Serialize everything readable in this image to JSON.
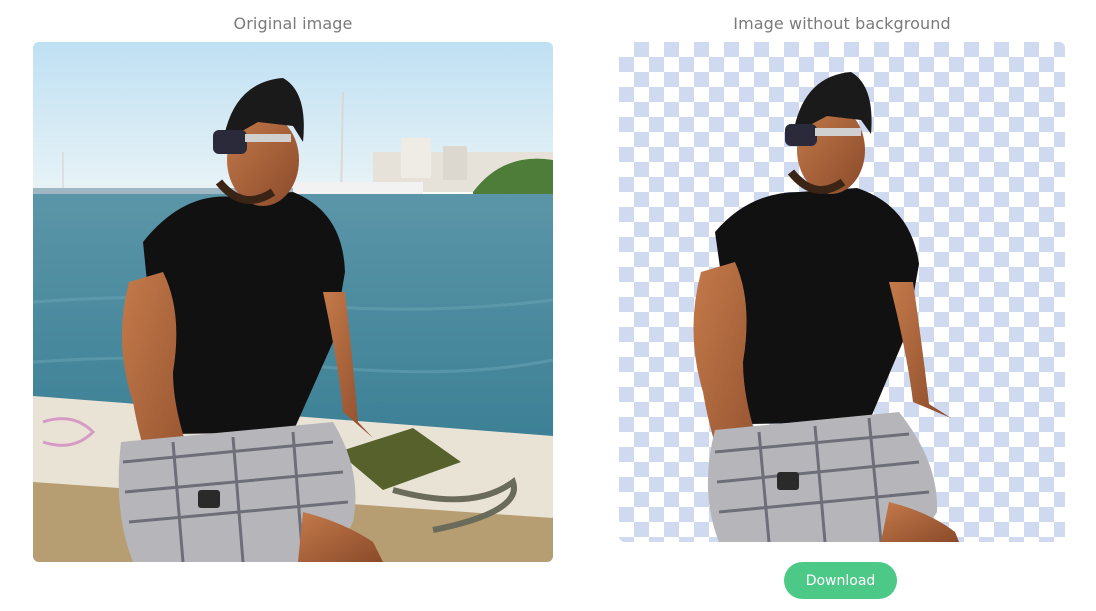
{
  "original_panel": {
    "title": "Original image"
  },
  "result_panel": {
    "title": "Image without background"
  },
  "actions": {
    "download_label": "Download"
  },
  "colors": {
    "accent": "#4cc987",
    "checker": "#cfd9f0",
    "title_text": "#7a7a7a"
  }
}
